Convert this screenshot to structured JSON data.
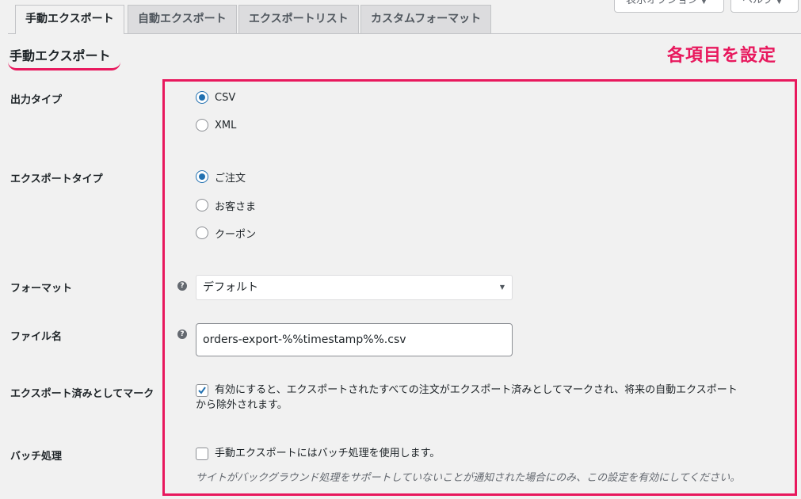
{
  "screen_meta": {
    "screen_options_label": "表示オプション",
    "help_label": "ヘルプ"
  },
  "tabs": [
    {
      "label": "手動エクスポート",
      "active": true
    },
    {
      "label": "自動エクスポート",
      "active": false
    },
    {
      "label": "エクスポートリスト",
      "active": false
    },
    {
      "label": "カスタムフォーマット",
      "active": false
    }
  ],
  "page_title": "手動エクスポート",
  "annotation_label": "各項目を設定",
  "fields": {
    "output_type": {
      "label": "出力タイプ",
      "options": [
        {
          "label": "CSV",
          "selected": true
        },
        {
          "label": "XML",
          "selected": false
        }
      ]
    },
    "export_type": {
      "label": "エクスポートタイプ",
      "options": [
        {
          "label": "ご注文",
          "selected": true
        },
        {
          "label": "お客さま",
          "selected": false
        },
        {
          "label": "クーポン",
          "selected": false
        }
      ]
    },
    "format": {
      "label": "フォーマット",
      "help_icon": "?",
      "selected": "デフォルト"
    },
    "filename": {
      "label": "ファイル名",
      "help_icon": "?",
      "value": "orders-export-%%timestamp%%.csv"
    },
    "mark_exported": {
      "label": "エクスポート済みとしてマーク",
      "checked": true,
      "text_line1": "有効にすると、エクスポートされたすべての注文がエクスポート済みとしてマークされ、将来の自動エクスポート",
      "text_line2": "から除外されます。"
    },
    "batch": {
      "label": "バッチ処理",
      "checked": false,
      "text": "手動エクスポートにはバッチ処理を使用します。",
      "description": "サイトがバックグラウンド処理をサポートしていないことが通知された場合にのみ、この設定を有効にしてください。"
    }
  },
  "colors": {
    "accent": "#e8185d",
    "wp_blue": "#2271b1",
    "background": "#f1f1f1"
  }
}
